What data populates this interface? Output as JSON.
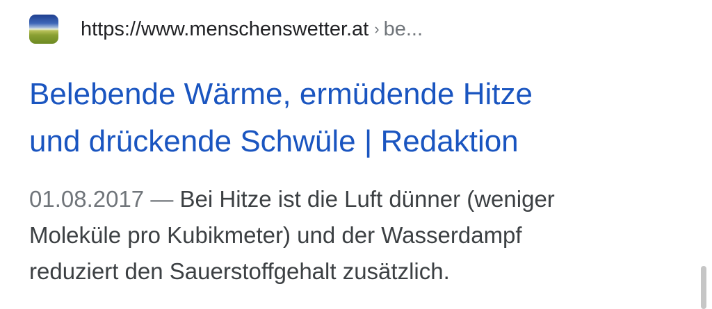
{
  "source": {
    "favicon": "menschenswetter-landscape-icon",
    "url": "https://www.menschenswetter.at",
    "separator": "›",
    "path": "be..."
  },
  "result": {
    "title_lines": [
      "Belebende Wärme, ermüdende Hitze",
      "und drückende Schwüle | Redaktion"
    ],
    "date": "01.08.2017",
    "date_separator": " — ",
    "snippet_lines": [
      "Bei Hitze ist die Luft dünner (weniger",
      "Moleküle pro Kubikmeter) und der Wasserdampf",
      "reduziert den Sauerstoffgehalt zusätzlich."
    ]
  },
  "colors": {
    "title_link": "#1a55c0",
    "url_text": "#202124",
    "muted_text": "#70757a",
    "body_text": "#3c4043"
  }
}
